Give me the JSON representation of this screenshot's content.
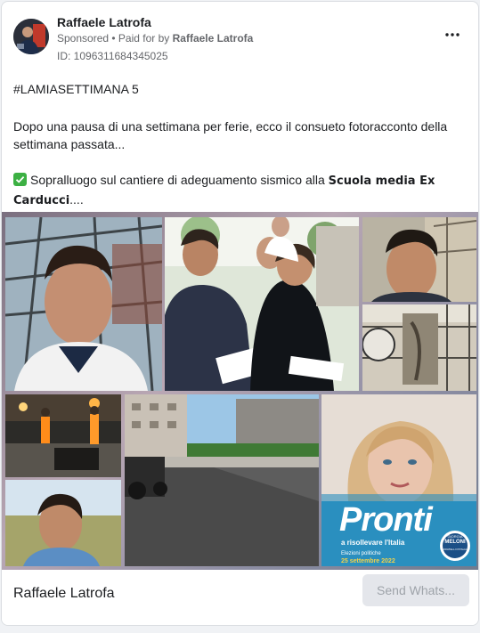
{
  "header": {
    "author": "Raffaele Latrofa",
    "sponsored": "Sponsored",
    "paid_for_prefix": " • Paid for by ",
    "paid_for_name": "Raffaele Latrofa",
    "ad_id": "ID: 1096311684345025",
    "more_icon": "more-horizontal-icon"
  },
  "post": {
    "hashtag": "#LAMIASETTIMANA 5",
    "paragraph1": "Dopo una pausa di una settimana per ferie, ecco il consueto fotoracconto della settimana passata...",
    "check_emoji": "check-mark-button-icon",
    "paragraph2_prefix": "Sopralluogo sul cantiere di adeguamento sismico alla ",
    "paragraph2_bold": "Scuola media Ex Carducci",
    "paragraph2_suffix": "...."
  },
  "collage": {
    "poster_title": "Pronti",
    "poster_subtitle": "a risollevare l'Italia",
    "poster_line1": "Elezioni politiche",
    "poster_line2": "25 settembre 2022",
    "poster_logo_top": "GIORGIA",
    "poster_logo_main": "MELONI",
    "poster_logo_sub": "FRATELLI D'ITALIA"
  },
  "footer": {
    "name": "Raffaele Latrofa",
    "cta_label": "Send Whats..."
  },
  "colors": {
    "check_green": "#3cb043",
    "text": "#1c1e21",
    "meta": "#65676b",
    "cta_bg": "#e4e6eb",
    "poster_blue": "#2a8fbf"
  }
}
